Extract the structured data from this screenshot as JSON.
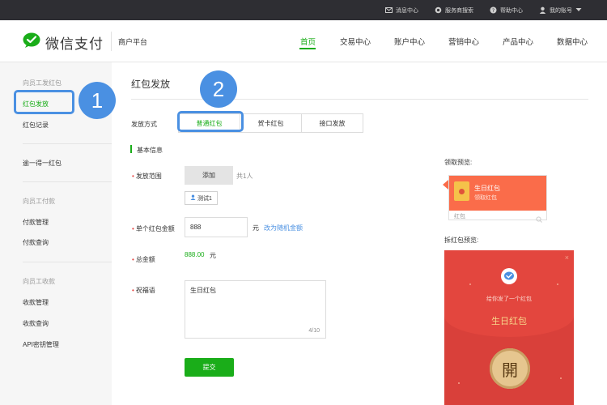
{
  "topbar": {
    "items": [
      {
        "label": "消息中心",
        "icon": "mail-icon"
      },
      {
        "label": "服务商搜索",
        "icon": "search-icon"
      },
      {
        "label": "帮助中心",
        "icon": "help-icon"
      },
      {
        "label": "我的账号",
        "icon": "user-icon"
      }
    ]
  },
  "header": {
    "logo_text": "微信支付",
    "subtitle": "商户平台",
    "nav": [
      "首页",
      "交易中心",
      "账户中心",
      "营销中心",
      "产品中心",
      "数据中心"
    ]
  },
  "sidebar": {
    "group1_title": "向员工发红包",
    "item_send": "红包发放",
    "item_records": "红包记录",
    "item_one": "逾一得一红包",
    "group2_title": "向员工付款",
    "item_pay_manage": "付款管理",
    "item_pay_query": "付款查询",
    "group3_title": "向员工收款",
    "item_collect_manage": "收款管理",
    "item_collect_query": "收款查询",
    "item_api": "API密钥管理"
  },
  "main": {
    "title": "红包发放",
    "method_label": "发放方式",
    "tabs": [
      "普通红包",
      "贺卡红包",
      "接口发放"
    ],
    "section_title": "基本信息",
    "scope_label": "发放范围",
    "add_button": "添加",
    "count_text": "共1人",
    "tag_text": "测试1",
    "amount_label": "单个红包金额",
    "amount_value": "888",
    "unit": "元",
    "random_link": "改为随机金额",
    "total_label": "总金额",
    "total_value": "888.00",
    "total_unit": "元",
    "blessing_label": "祝福语",
    "blessing_value": "生日红包",
    "blessing_counter": "4/10",
    "submit_button": "提交"
  },
  "preview": {
    "receive_label": "领取预览:",
    "card_title": "生日红包",
    "card_sub": "领取红包",
    "card_footer": "红包",
    "open_label": "拆红包预览:",
    "open_sender": "给你发了一个红包",
    "open_title": "生日红包",
    "open_button": "開"
  },
  "callouts": [
    "1",
    "2"
  ],
  "colors": {
    "accent": "#1aad19",
    "callout": "#4a90e2",
    "redpacket": "#d9403a"
  }
}
